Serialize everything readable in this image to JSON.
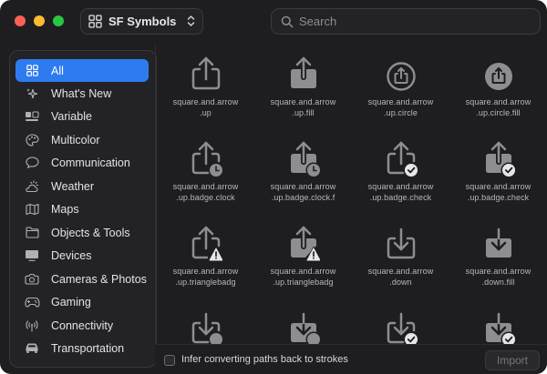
{
  "window": {
    "title": "SF Symbols",
    "controls": [
      "close",
      "minimize",
      "zoom"
    ]
  },
  "search": {
    "placeholder": "Search",
    "value": ""
  },
  "sidebar": {
    "items": [
      {
        "label": "All",
        "icon": "grid-icon",
        "selected": true
      },
      {
        "label": "What's New",
        "icon": "sparkle-icon",
        "selected": false
      },
      {
        "label": "Variable",
        "icon": "variable-icon",
        "selected": false
      },
      {
        "label": "Multicolor",
        "icon": "palette-icon",
        "selected": false
      },
      {
        "label": "Communication",
        "icon": "speech-bubble-icon",
        "selected": false
      },
      {
        "label": "Weather",
        "icon": "cloud-sun-icon",
        "selected": false
      },
      {
        "label": "Maps",
        "icon": "map-icon",
        "selected": false
      },
      {
        "label": "Objects & Tools",
        "icon": "folder-icon",
        "selected": false
      },
      {
        "label": "Devices",
        "icon": "display-icon",
        "selected": false
      },
      {
        "label": "Cameras & Photos",
        "icon": "camera-icon",
        "selected": false
      },
      {
        "label": "Gaming",
        "icon": "gamecontroller-icon",
        "selected": false
      },
      {
        "label": "Connectivity",
        "icon": "antenna-icon",
        "selected": false
      },
      {
        "label": "Transportation",
        "icon": "car-icon",
        "selected": false
      }
    ]
  },
  "symbols": [
    {
      "line1": "square.and.arrow",
      "line2": ".up"
    },
    {
      "line1": "square.and.arrow",
      "line2": ".up.fill"
    },
    {
      "line1": "square.and.arrow",
      "line2": ".up.circle"
    },
    {
      "line1": "square.and.arrow",
      "line2": ".up.circle.fill"
    },
    {
      "line1": "square.and.arrow",
      "line2": ".up.badge.clock"
    },
    {
      "line1": "square.and.arrow",
      "line2": ".up.badge.clock.f"
    },
    {
      "line1": "square.and.arrow",
      "line2": ".up.badge.check"
    },
    {
      "line1": "square.and.arrow",
      "line2": ".up.badge.check"
    },
    {
      "line1": "square.and.arrow",
      "line2": ".up.trianglebadg"
    },
    {
      "line1": "square.and.arrow",
      "line2": ".up.trianglebadg"
    },
    {
      "line1": "square.and.arrow",
      "line2": ".down"
    },
    {
      "line1": "square.and.arrow",
      "line2": ".down.fill"
    },
    {
      "line1": "",
      "line2": ""
    },
    {
      "line1": "",
      "line2": ""
    },
    {
      "line1": "",
      "line2": ""
    },
    {
      "line1": "",
      "line2": ""
    }
  ],
  "bottom_bar": {
    "checkbox_label": "Infer converting paths back to strokes",
    "checkbox_checked": false,
    "import_label": "Import"
  },
  "colors": {
    "accent": "#2e7bf0",
    "window_bg": "#1e1e21",
    "symbol_gray": "#8d8d92"
  }
}
